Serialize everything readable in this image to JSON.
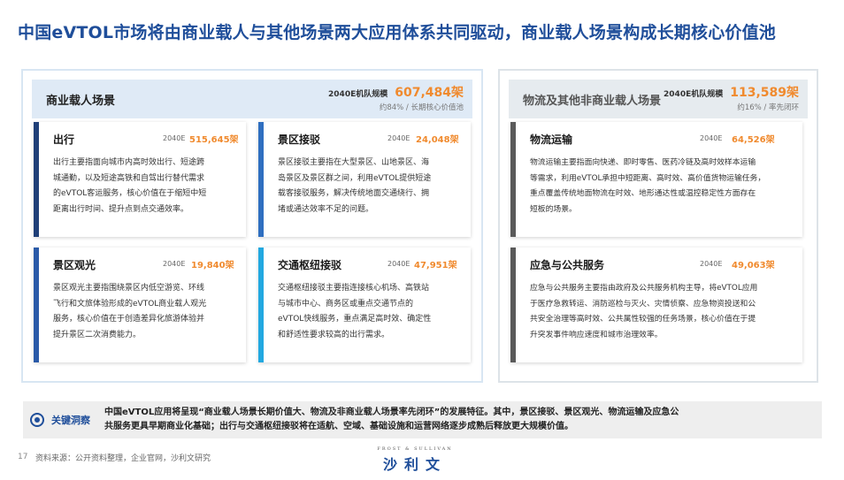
{
  "title": "中国eVTOL市场将由商业载人与其他场景两大应用体系共同驱动，商业载人场景构成长期核心价值池",
  "left_panel": {
    "title": "商业载人场景",
    "stat_label": "2040E机队规模",
    "stat_value": "607,484架",
    "stat_sub": "约84% / 长期核心价值池",
    "cards": [
      {
        "title": "出行",
        "year": "2040E",
        "value": "515,645架",
        "color": "#1f3f78",
        "lines": [
          "出行主要指面向城市内高时效出行、短途跨",
          "城通勤，以及短途高铁和自驾出行替代需求",
          "的eVTOL客运服务，核心价值在于缩短中短",
          "距离出行时间、提升点到点交通效率。"
        ]
      },
      {
        "title": "景区接驳",
        "year": "2040E",
        "value": "24,048架",
        "color": "#2f6fc0",
        "lines": [
          "景区接驳主要指在大型景区、山地景区、海",
          "岛景区及景区群之间，利用eVTOL提供短途",
          "载客接驳服务，解决传统地面交通绕行、拥",
          "堵或通达效率不足的问题。"
        ]
      },
      {
        "title": "景区观光",
        "year": "2040E",
        "value": "19,840架",
        "color": "#2a5aa8",
        "lines": [
          "景区观光主要指围绕景区内低空游览、环线",
          "飞行和文旅体验形成的eVTOL商业载人观光",
          "服务，核心价值在于创造差异化旅游体验并",
          "提升景区二次消费能力。"
        ]
      },
      {
        "title": "交通枢纽接驳",
        "year": "2040E",
        "value": "47,951架",
        "color": "#22a8e0",
        "lines": [
          "交通枢纽接驳主要指连接核心机场、高铁站",
          "与城市中心、商务区或重点交通节点的",
          "eVTOL快线服务，重点满足高时效、确定性",
          "和舒适性要求较高的出行需求。"
        ]
      }
    ]
  },
  "right_panel": {
    "title": "物流及其他非商业载人场景",
    "stat_label": "2040E机队规模",
    "stat_value": "113,589架",
    "stat_sub": "约16% / 率先闭环",
    "cards": [
      {
        "title": "物流运输",
        "year": "2040E",
        "value": "64,526架",
        "color": "#5a5a5a",
        "lines": [
          "物流运输主要指面向快递、即时零售、医药冷链及高时效样本运输",
          "等需求，利用eVTOL承担中短距离、高时效、高价值货物运输任务，",
          "重点覆盖传统地面物流在时效、地形通达性或温控稳定性方面存在",
          "短板的场景。"
        ]
      },
      {
        "title": "应急与公共服务",
        "year": "2040E",
        "value": "49,063架",
        "color": "#5a5a5a",
        "lines": [
          "应急与公共服务主要指由政府及公共服务机构主导，将eVTOL应用",
          "于医疗急救转运、消防巡检与灭火、灾情侦察、应急物资投送和公",
          "共安全治理等高时效、公共属性较强的任务场景，核心价值在于提",
          "升突发事件响应速度和城市治理效率。"
        ]
      }
    ]
  },
  "insight": {
    "label": "关键洞察",
    "lines": [
      "中国eVTOL应用将呈现“商业载人场景长期价值大、物流及非商业载人场景率先闭环”的发展特征。其中，景区接驳、景区观光、物流运输及应急公",
      "共服务更具早期商业化基础；出行与交通枢纽接驳将在适航、空域、基础设施和运营网络逐步成熟后释放更大规模价值。"
    ]
  },
  "footer": {
    "page": "17",
    "source": "资料来源：公开资料整理，企业官网，沙利文研究",
    "logo_en": "FROST & SULLIVAN",
    "logo_cn": "沙利文"
  }
}
